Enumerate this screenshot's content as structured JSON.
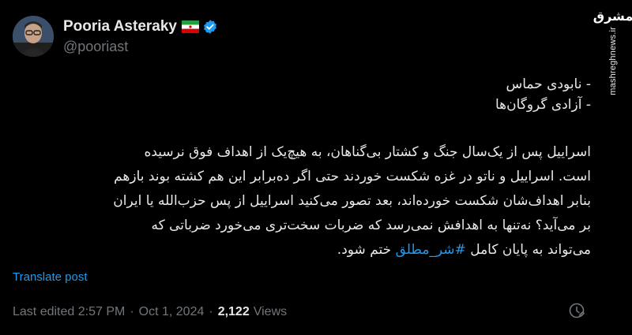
{
  "author": {
    "name": "Pooria Asteraky",
    "handle": "@pooriast",
    "flag_icon": "iran-flag-icon",
    "verified_icon": "verified-badge-icon",
    "verified_color": "#1d9bf0"
  },
  "watermark": {
    "logo_text": "مشرق",
    "url": "mashreghnews.ir"
  },
  "post": {
    "bullet_lines": [
      "- نابودی حماس",
      "- آزادی گروگان‌ها"
    ],
    "paragraph_lines": [
      "اسراییل پس از یک‌سال جنگ و کشتار بی‌گناهان، به هیچ‌یک از اهداف فوق نرسیده",
      "است. اسراییل و ناتو در غزه شکست خوردند حتی اگر ده‌برابر این هم کشته بوند بازهم",
      "بنابر اهداف‌شان شکست خورده‌اند، بعد تصور می‌کنید  اسراییل از پس حزب‌الله یا ایران",
      "بر می‌آید؟ نه‌تنها به اهدافش نمی‌رسد که ضربات سخت‌تری می‌خورد ضرباتی که"
    ],
    "last_line_text": "می‌تواند به پایان کامل ",
    "hashtag": "#شر_مطلق",
    "last_line_end": " ختم شود."
  },
  "translate_label": "Translate post",
  "meta": {
    "edited_label": "Last edited 2:57 PM",
    "separator": "·",
    "date": "Oct 1, 2024",
    "views_count": "2,122",
    "views_label": "Views"
  },
  "colors": {
    "background": "#000000",
    "text": "#e7e9ea",
    "muted": "#71767b",
    "link": "#1d9bf0"
  }
}
